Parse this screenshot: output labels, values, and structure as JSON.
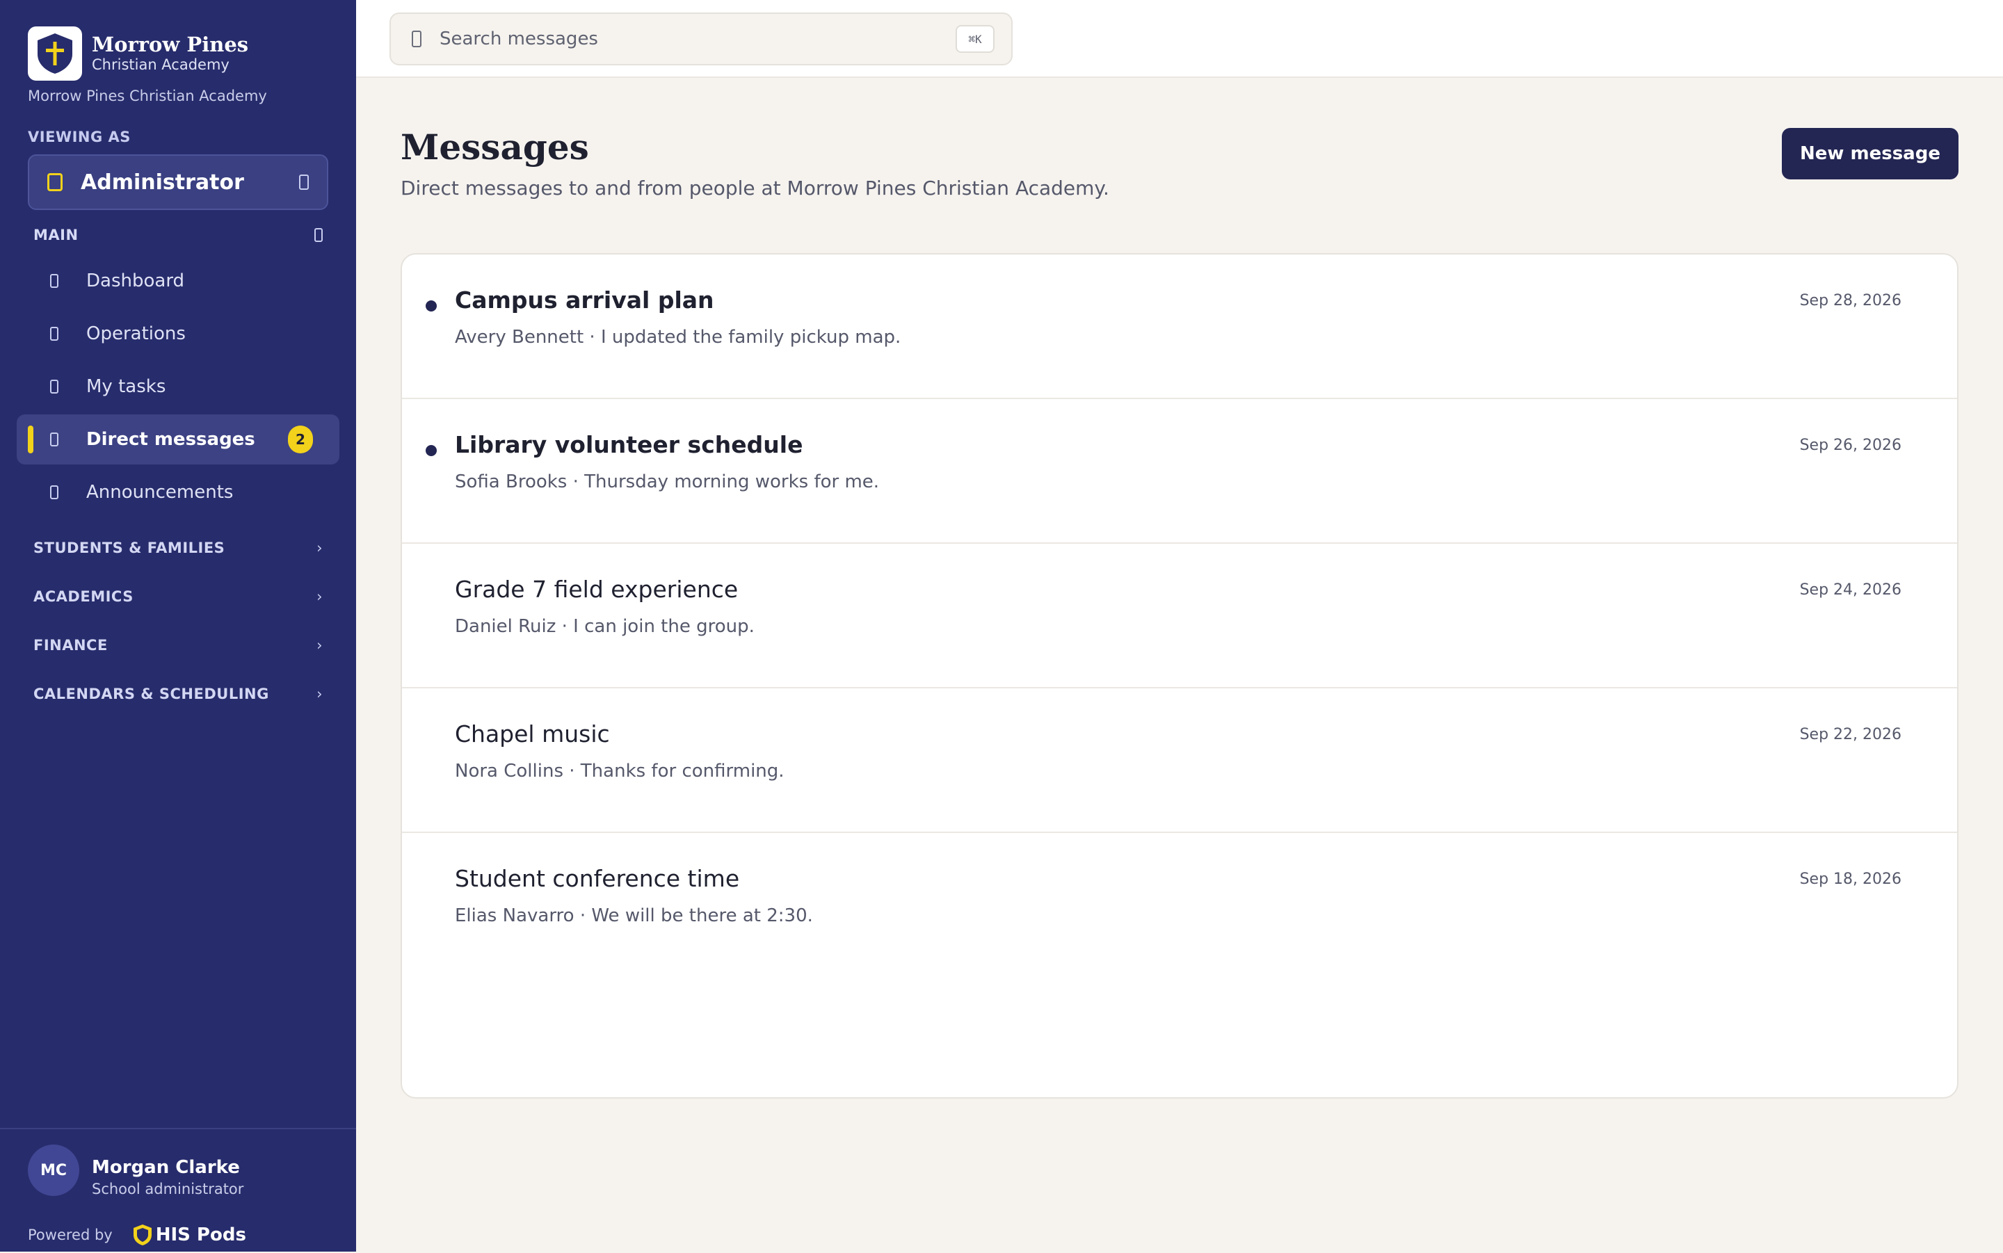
{
  "brand": {
    "name": "Morrow Pines",
    "sub": "Christian Academy",
    "full": "Morrow Pines Christian Academy"
  },
  "viewing_as": {
    "label": "VIEWING AS",
    "role": "Administrator"
  },
  "nav": {
    "main_label": "MAIN",
    "items": [
      {
        "label": "Dashboard"
      },
      {
        "label": "Operations"
      },
      {
        "label": "My tasks"
      },
      {
        "label": "Direct messages",
        "badge": "2",
        "active": true
      },
      {
        "label": "Announcements"
      }
    ],
    "groups": [
      {
        "label": "STUDENTS & FAMILIES"
      },
      {
        "label": "ACADEMICS"
      },
      {
        "label": "FINANCE"
      },
      {
        "label": "CALENDARS & SCHEDULING"
      }
    ],
    "chevron": "›"
  },
  "user": {
    "initials": "MC",
    "name": "Morgan Clarke",
    "role": "School administrator"
  },
  "footer": {
    "powered_by": "Powered by",
    "product": "HIS Pods"
  },
  "search": {
    "placeholder": "Search messages",
    "shortcut": "⌘K"
  },
  "page": {
    "title": "Messages",
    "subtitle": "Direct messages to and from people at Morrow Pines Christian Academy.",
    "new_button": "New message"
  },
  "messages": [
    {
      "subject": "Campus arrival plan",
      "preview": "Avery Bennett · I updated the family pickup map.",
      "date": "Sep 28, 2026",
      "unread": true
    },
    {
      "subject": "Library volunteer schedule",
      "preview": "Sofia Brooks · Thursday morning works for me.",
      "date": "Sep 26, 2026",
      "unread": true
    },
    {
      "subject": "Grade 7 field experience",
      "preview": "Daniel Ruiz · I can join the group.",
      "date": "Sep 24, 2026",
      "unread": false
    },
    {
      "subject": "Chapel music",
      "preview": "Nora Collins · Thanks for confirming.",
      "date": "Sep 22, 2026",
      "unread": false
    },
    {
      "subject": "Student conference time",
      "preview": "Elias Navarro · We will be there at 2:30.",
      "date": "Sep 18, 2026",
      "unread": false
    }
  ],
  "colors": {
    "sidebar": "#272c6c",
    "accent": "#f2d21b",
    "primary_button": "#232653",
    "background": "#f6f3ef"
  },
  "icons": {
    "logo": "shield-cross-icon",
    "role": "user-badge-icon",
    "role_menu": "chevron-updown-icon",
    "search": "search-icon",
    "dashboard": "dashboard-icon",
    "operations": "operations-icon",
    "tasks": "tasks-icon",
    "messages": "message-icon",
    "announcements": "megaphone-icon"
  }
}
